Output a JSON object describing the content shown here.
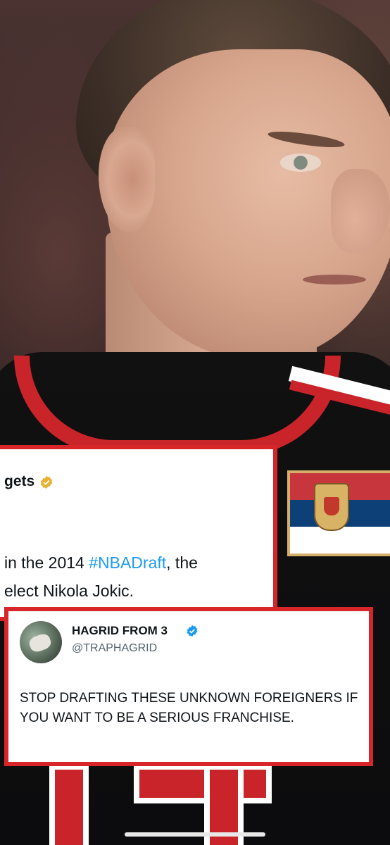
{
  "top_tweet": {
    "account_name": "gets",
    "line1_prefix": "in the 2014 ",
    "line1_hashtag": "#NBADraft",
    "line1_suffix": ", the",
    "line2": "elect Nikola Jokic."
  },
  "reply_tweet": {
    "display_name": "HAGRID FROM 3",
    "handle": "@TRAPHAGRID",
    "text": "STOP DRAFTING THESE UNKNOWN FOREIGNERS IF YOU WANT TO BE A SERIOUS FRANCHISE."
  },
  "colors": {
    "card_border": "#d8252a",
    "hashtag": "#1d9bf0",
    "gold_badge": "#e6b12e",
    "blue_badge": "#1d9bf0"
  },
  "icons": {
    "top_badge": "gold-verified-icon",
    "reply_badge": "blue-verified-icon"
  }
}
